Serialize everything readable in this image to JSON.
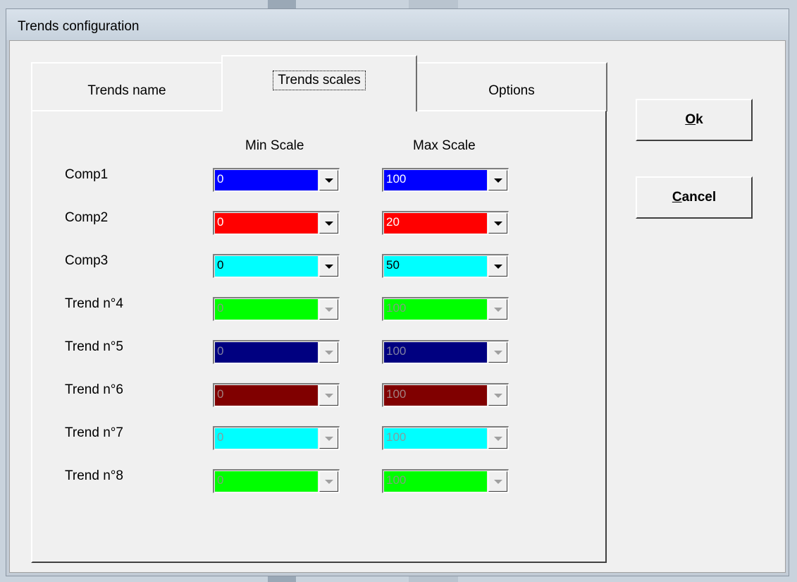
{
  "window": {
    "title": "Trends configuration"
  },
  "tabs": [
    {
      "label": "Trends name",
      "active": false
    },
    {
      "label": "Trends scales",
      "active": true
    },
    {
      "label": "Options",
      "active": false
    }
  ],
  "columns": {
    "min": "Min Scale",
    "max": "Max Scale"
  },
  "rows": [
    {
      "label": "Comp1",
      "min": "0",
      "max": "100",
      "color": "#0000ff",
      "text_color": "#ffffff",
      "enabled": true
    },
    {
      "label": "Comp2",
      "min": "0",
      "max": "20",
      "color": "#ff0000",
      "text_color": "#ffffff",
      "enabled": true
    },
    {
      "label": "Comp3",
      "min": "0",
      "max": "50",
      "color": "#00ffff",
      "text_color": "#000000",
      "enabled": true
    },
    {
      "label": "Trend n°4",
      "min": "0",
      "max": "100",
      "color": "#00ff00",
      "text_color": "#7f9f7f",
      "enabled": false
    },
    {
      "label": "Trend n°5",
      "min": "0",
      "max": "100",
      "color": "#000080",
      "text_color": "#8080a0",
      "enabled": false
    },
    {
      "label": "Trend n°6",
      "min": "0",
      "max": "100",
      "color": "#800000",
      "text_color": "#a08080",
      "enabled": false
    },
    {
      "label": "Trend n°7",
      "min": "0",
      "max": "100",
      "color": "#00ffff",
      "text_color": "#7fa0a0",
      "enabled": false
    },
    {
      "label": "Trend n°8",
      "min": "0",
      "max": "100",
      "color": "#00ff00",
      "text_color": "#7f9f7f",
      "enabled": false
    }
  ],
  "buttons": {
    "ok": {
      "accel": "O",
      "rest": "k"
    },
    "cancel": {
      "accel": "C",
      "rest": "ancel"
    }
  }
}
